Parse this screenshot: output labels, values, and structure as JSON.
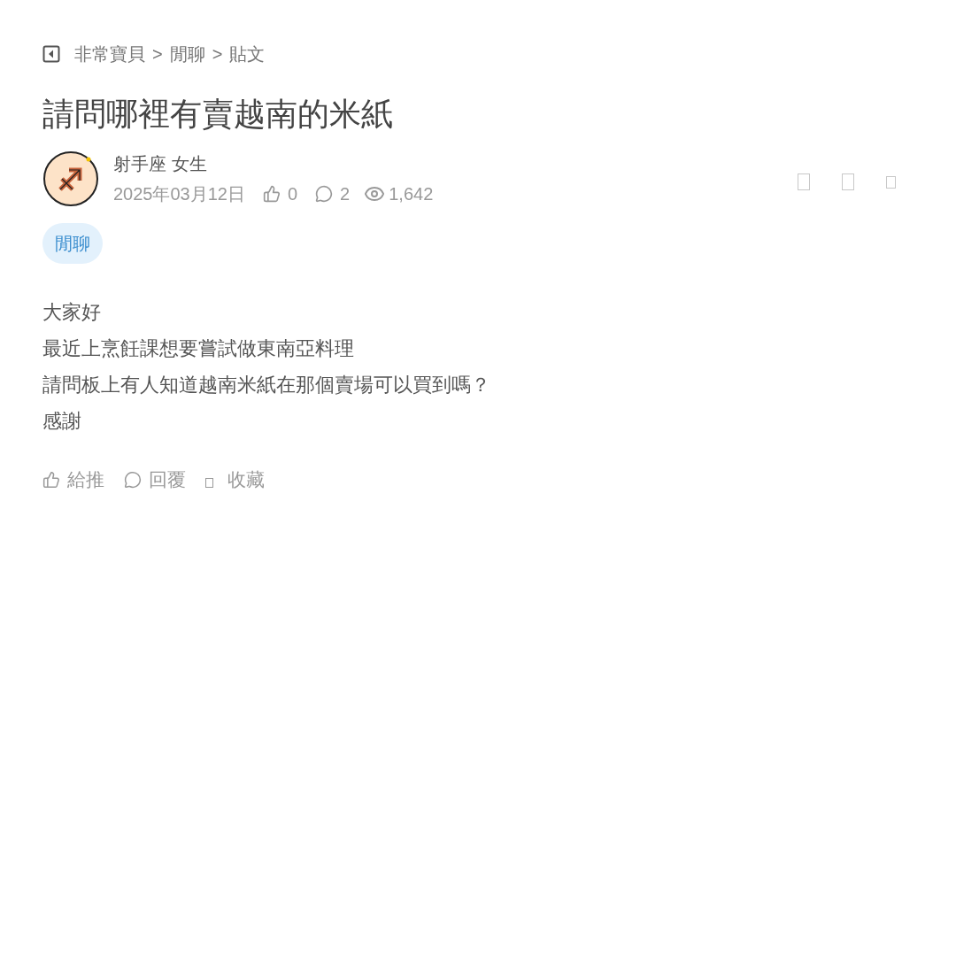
{
  "breadcrumb": [
    "非常寶貝",
    "閒聊",
    "貼文"
  ],
  "breadcrumb_separator": ">",
  "title": "請問哪裡有賣越南的米紙",
  "author": {
    "name": "射手座 女生",
    "date": "2025年03月12日",
    "likes": "0",
    "comments": "2",
    "views": "1,642"
  },
  "tag": "閒聊",
  "body": [
    "大家好",
    "最近上烹飪課想要嘗試做東南亞料理",
    "請問板上有人知道越南米紙在那個賣場可以買到嗎？",
    "感謝"
  ],
  "actions": [
    {
      "kind": "like",
      "label": "給推"
    },
    {
      "kind": "reply",
      "label": "回覆"
    },
    {
      "kind": "save",
      "label": "收藏"
    }
  ]
}
